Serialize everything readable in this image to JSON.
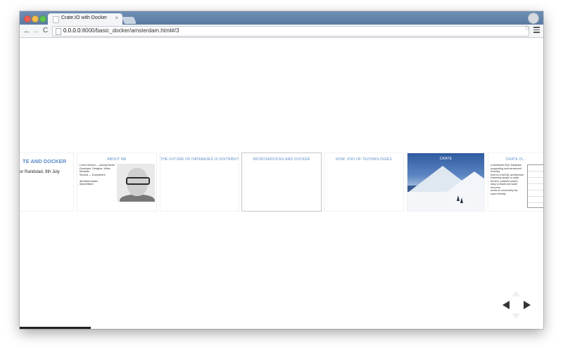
{
  "browser": {
    "tab_title": "Crate.IO with Docker",
    "tab_close": "×",
    "url_host": "0.0.0.0",
    "url_rest": ":8000/basic_docker/amsterdam.html#/3",
    "star": "☆"
  },
  "slides": [
    {
      "title": "TE AND DOCKER",
      "subtitle": "or Randstad, 9th July"
    },
    {
      "title": "ABOUT ME",
      "bio": "Lorem Mollum — pkuerja Berlin\nDeveloper, Designer, Writer\nMusician\nSeveral — Everywhere\n\n@mollumclassic\nlanserblikien"
    },
    {
      "title": "THE FUTURE OF DATABASES IS DISTRIBUTED"
    },
    {
      "title": "MICROSERVICES AND DOCKER"
    },
    {
      "title": "NOW: ZOO OF TECHNOLOGIES"
    },
    {
      "title": "CRATE"
    },
    {
      "title": "CRATE IS...",
      "body": "a distributed SQL Database\n(supporting semi-structured records)\nbuilt on a NoSQL architecture\nextremely simple to scale\nfull-text, powerful search\neasy to install and scale\nrecovery\nworks on commodity hw\nsuper friendly"
    }
  ],
  "colors": {
    "accent": "#5b8cc8",
    "progress": "#222222"
  },
  "icons": {
    "nav": [
      "arrow-left-icon",
      "arrow-right-icon",
      "arrow-up-icon",
      "arrow-down-icon"
    ]
  }
}
